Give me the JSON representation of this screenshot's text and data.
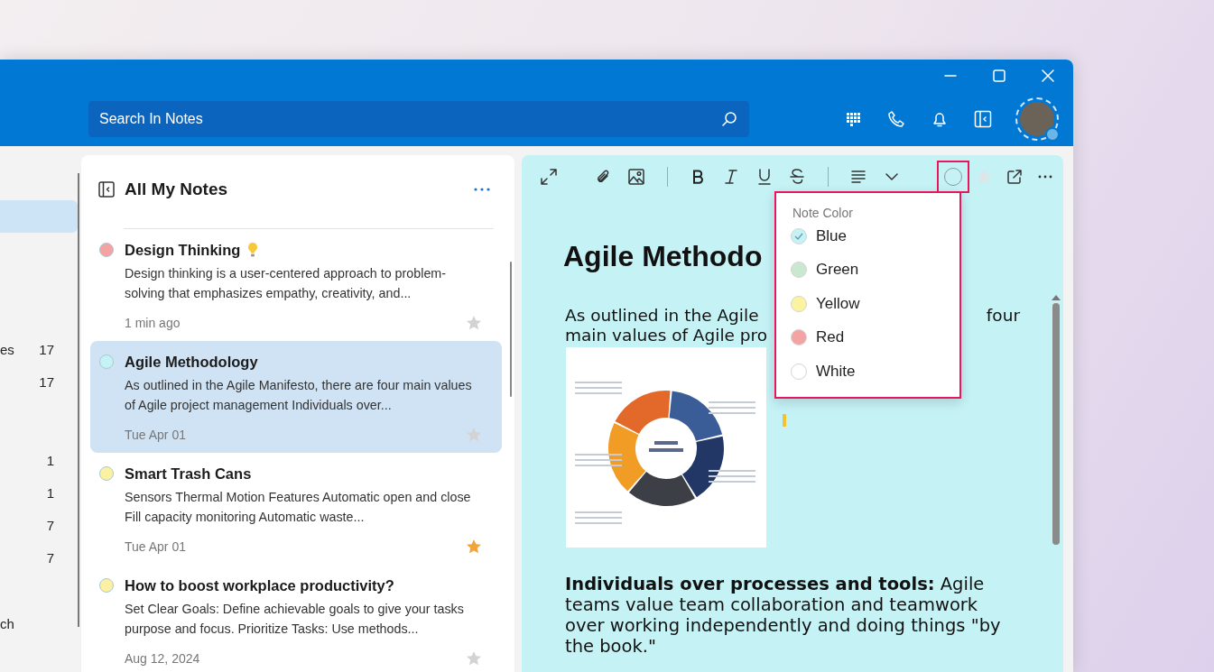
{
  "search": {
    "placeholder": "Search In Notes"
  },
  "sidebar": {
    "items": [
      {
        "selected": true
      },
      {
        "label": "es",
        "count": "17",
        "selected": false
      },
      {
        "count": "17",
        "selected": false
      },
      {
        "count": "1",
        "selected": false
      },
      {
        "count": "1",
        "selected": false
      },
      {
        "count": "7",
        "selected": false
      },
      {
        "count": "7",
        "selected": false
      },
      {
        "label": "ch",
        "selected": false
      }
    ]
  },
  "notes_list": {
    "title": "All My Notes",
    "notes": [
      {
        "title": "Design Thinking",
        "has_idea_icon": true,
        "preview": "Design thinking is a user-centered approach to problem-solving that emphasizes empathy, creativity, and...",
        "time": "1 min ago",
        "color": "#f4a3a3",
        "starred": false,
        "selected": false
      },
      {
        "title": "Agile Methodology",
        "has_idea_icon": false,
        "preview": "As outlined in the Agile Manifesto, there are four main values of Agile project management Individuals over...",
        "time": "Tue Apr 01",
        "color": "#c5f2f5",
        "starred": false,
        "selected": true
      },
      {
        "title": "Smart Trash Cans",
        "has_idea_icon": false,
        "preview": "Sensors Thermal Motion Features Automatic open and close Fill capacity monitoring Automatic waste...",
        "time": "Tue Apr 01",
        "color": "#fbf1a3",
        "starred": true,
        "selected": false
      },
      {
        "title": "How to boost workplace productivity?",
        "has_idea_icon": false,
        "preview": "Set Clear Goals: Define achievable goals to give your tasks purpose and focus. Prioritize Tasks: Use methods...",
        "time": "Aug 12, 2024",
        "color": "#fbf1a3",
        "starred": false,
        "selected": false
      }
    ]
  },
  "editor": {
    "toolbar": {
      "color_menu_open": true,
      "starred": false
    },
    "title": "Agile Methodo",
    "paragraph_1": {
      "lines": [
        "As outlined in the Agile",
        "main values of Agile pro"
      ],
      "right_fragment": "four"
    },
    "paragraph_2": "**Individuals over processes and tools:** Agile teams value team collaboration and teamwork over working independently and doing things \"by the book.\""
  },
  "note_color_menu": {
    "heading": "Note Color",
    "options": [
      {
        "label": "Blue",
        "color": "#c5f2f5",
        "selected": true
      },
      {
        "label": "Green",
        "color": "#c9e8cf",
        "selected": false
      },
      {
        "label": "Yellow",
        "color": "#fbf3a0",
        "selected": false
      },
      {
        "label": "Red",
        "color": "#f4a3a3",
        "selected": false
      },
      {
        "label": "White",
        "color": "#ffffff",
        "selected": false
      }
    ]
  }
}
